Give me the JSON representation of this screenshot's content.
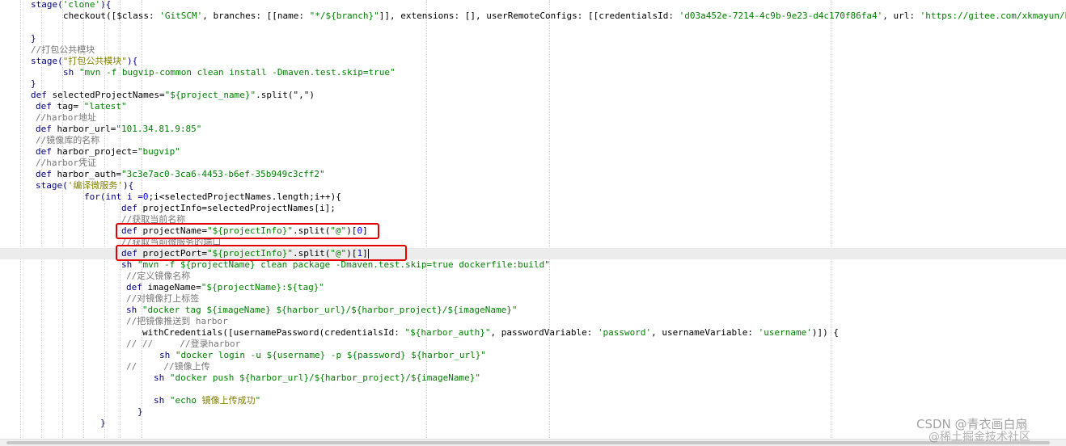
{
  "code": {
    "lines": [
      {
        "segments": [
          {
            "t": "stage(",
            "c": "k"
          },
          {
            "t": "'clone'",
            "c": "s"
          },
          {
            "t": "){",
            "c": "k"
          }
        ]
      },
      {
        "segments": [
          {
            "t": "checkout([$class: ",
            "c": ""
          },
          {
            "t": "'GitSCM'",
            "c": "s"
          },
          {
            "t": ", branches: [[name: ",
            "c": ""
          },
          {
            "t": "\"*/${branch}\"",
            "c": "s"
          },
          {
            "t": "]], extensions: [], userRemoteConfigs: [[credentialsId: ",
            "c": ""
          },
          {
            "t": "'d03a452e-7214-4c9b-9e23-d4c170f86fa4'",
            "c": "s"
          },
          {
            "t": ", url: ",
            "c": ""
          },
          {
            "t": "'https://gitee.com/xkmayun/b",
            "c": "s"
          }
        ]
      },
      {
        "segments": []
      },
      {
        "segments": [
          {
            "t": "}",
            "c": "k"
          }
        ]
      },
      {
        "segments": [
          {
            "t": "//打包公共模块",
            "c": "c"
          }
        ]
      },
      {
        "segments": [
          {
            "t": "stage(",
            "c": "k"
          },
          {
            "t": "\"打包公共模块\"",
            "c": "cn"
          },
          {
            "t": "){",
            "c": "k"
          }
        ]
      },
      {
        "segments": [
          {
            "t": "sh ",
            "c": "k"
          },
          {
            "t": "\"mvn -f bugvip-common clean install -Dmaven.test.skip=true\"",
            "c": "s"
          }
        ]
      },
      {
        "segments": [
          {
            "t": "}",
            "c": "k"
          }
        ]
      },
      {
        "segments": [
          {
            "t": "def ",
            "c": "k"
          },
          {
            "t": "selectedProjectNames=",
            "c": ""
          },
          {
            "t": "\"${project_name}\"",
            "c": "s"
          },
          {
            "t": ".split(\",\")",
            "c": ""
          }
        ]
      },
      {
        "segments": [
          {
            "t": "def ",
            "c": "k"
          },
          {
            "t": "tag= ",
            "c": ""
          },
          {
            "t": "\"latest\"",
            "c": "s"
          }
        ]
      },
      {
        "segments": [
          {
            "t": "//harbor地址",
            "c": "c"
          }
        ]
      },
      {
        "segments": [
          {
            "t": "def ",
            "c": "k"
          },
          {
            "t": "harbor_url=",
            "c": ""
          },
          {
            "t": "\"101.34.81.9:85\"",
            "c": "s"
          }
        ]
      },
      {
        "segments": [
          {
            "t": "//镜像库的名称",
            "c": "c"
          }
        ]
      },
      {
        "segments": [
          {
            "t": "def ",
            "c": "k"
          },
          {
            "t": "harbor_project=",
            "c": ""
          },
          {
            "t": "\"bugvip\"",
            "c": "s"
          }
        ]
      },
      {
        "segments": [
          {
            "t": "//harbor凭证",
            "c": "c"
          }
        ]
      },
      {
        "segments": [
          {
            "t": "def ",
            "c": "k"
          },
          {
            "t": "harbor_auth=",
            "c": ""
          },
          {
            "t": "\"3c3e7ac0-3ca6-4453-b6ef-35b949c3cff2\"",
            "c": "s"
          }
        ]
      },
      {
        "segments": [
          {
            "t": "stage(",
            "c": "k"
          },
          {
            "t": "'编译微服务'",
            "c": "cn"
          },
          {
            "t": "){",
            "c": "k"
          }
        ]
      },
      {
        "segments": [
          {
            "t": "for(int i =",
            "c": "k"
          },
          {
            "t": "0",
            "c": "n"
          },
          {
            "t": ";i<selectedProjectNames.length;i++){",
            "c": ""
          }
        ]
      },
      {
        "segments": [
          {
            "t": "def ",
            "c": "k"
          },
          {
            "t": "projectInfo=selectedProjectNames[i];",
            "c": ""
          }
        ]
      },
      {
        "segments": [
          {
            "t": "//获取当前名称",
            "c": "c"
          }
        ]
      },
      {
        "segments": [
          {
            "t": "def ",
            "c": "k"
          },
          {
            "t": "projectName=",
            "c": ""
          },
          {
            "t": "\"${projectInfo}\"",
            "c": "s"
          },
          {
            "t": ".split(",
            "c": ""
          },
          {
            "t": "\"@\"",
            "c": "s"
          },
          {
            "t": ")[",
            "c": ""
          },
          {
            "t": "0",
            "c": "n"
          },
          {
            "t": "]",
            "c": ""
          }
        ]
      },
      {
        "segments": [
          {
            "t": "//获取当前微服务的端口",
            "c": "c"
          }
        ]
      },
      {
        "segments": [
          {
            "t": "def ",
            "c": "k"
          },
          {
            "t": "projectPort=",
            "c": ""
          },
          {
            "t": "\"${projectInfo}\"",
            "c": "s"
          },
          {
            "t": ".split(",
            "c": ""
          },
          {
            "t": "\"@\"",
            "c": "s"
          },
          {
            "t": ")[",
            "c": ""
          },
          {
            "t": "1",
            "c": "n"
          },
          {
            "t": "]",
            "c": ""
          }
        ]
      },
      {
        "segments": [
          {
            "t": "sh ",
            "c": "k"
          },
          {
            "t": "\"mvn -f ${projectName} clean package -Dmaven.test.skip=true dockerfile:build\"",
            "c": "s"
          }
        ]
      },
      {
        "segments": [
          {
            "t": "//定义镜像名称",
            "c": "c"
          }
        ]
      },
      {
        "segments": [
          {
            "t": "def ",
            "c": "k"
          },
          {
            "t": "imageName=",
            "c": ""
          },
          {
            "t": "\"${projectName}:${tag}\"",
            "c": "s"
          }
        ]
      },
      {
        "segments": [
          {
            "t": "//对镜像打上标签",
            "c": "c"
          }
        ]
      },
      {
        "segments": [
          {
            "t": "sh ",
            "c": "k"
          },
          {
            "t": "\"docker tag ${imageName} ${harbor_url}/${harbor_project}/${imageName}\"",
            "c": "s"
          }
        ]
      },
      {
        "segments": [
          {
            "t": "//把镜像推送到 harbor",
            "c": "c"
          }
        ]
      },
      {
        "segments": [
          {
            "t": "withCredentials([usernamePassword(credentialsId: ",
            "c": ""
          },
          {
            "t": "\"${harbor_auth}\"",
            "c": "s"
          },
          {
            "t": ", passwordVariable: ",
            "c": ""
          },
          {
            "t": "'password'",
            "c": "s"
          },
          {
            "t": ", usernameVariable: ",
            "c": ""
          },
          {
            "t": "'username'",
            "c": "s"
          },
          {
            "t": ")]) {",
            "c": ""
          }
        ]
      },
      {
        "segments": [
          {
            "t": "// //     //登录harbor",
            "c": "c"
          }
        ]
      },
      {
        "segments": [
          {
            "t": "sh ",
            "c": "k"
          },
          {
            "t": "\"docker login -u ${username} -p ${password} ${harbor_url}\"",
            "c": "s"
          }
        ]
      },
      {
        "segments": [
          {
            "t": "//     //镜像上传",
            "c": "c"
          }
        ]
      },
      {
        "segments": [
          {
            "t": "sh ",
            "c": "k"
          },
          {
            "t": "\"docker push ${harbor_url}/${harbor_project}/${imageName}\"",
            "c": "s"
          }
        ]
      },
      {
        "segments": []
      },
      {
        "segments": [
          {
            "t": "sh ",
            "c": "k"
          },
          {
            "t": "\"echo ",
            "c": "s"
          },
          {
            "t": "镜像上传成功",
            "c": "cn"
          },
          {
            "t": "\"",
            "c": "s"
          }
        ]
      },
      {
        "segments": [
          {
            "t": "}",
            "c": "k"
          }
        ]
      },
      {
        "segments": [
          {
            "t": "}",
            "c": "k"
          }
        ]
      }
    ]
  },
  "watermark": {
    "line1": "CSDN @青衣画白扇",
    "line2": "@稀土掘金技术社区"
  }
}
